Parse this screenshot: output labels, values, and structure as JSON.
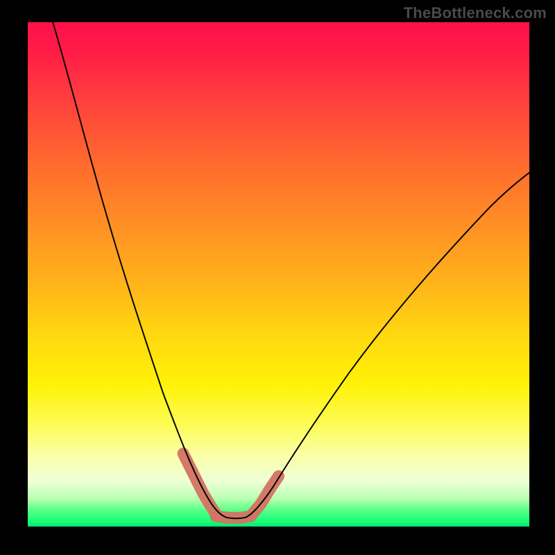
{
  "watermark": "TheBottleneck.com",
  "colors": {
    "background": "#000000",
    "watermark_text": "#4a4a4a",
    "curve": "#050505",
    "highlight": "#d47364"
  },
  "chart_data": {
    "type": "line",
    "title": "",
    "xlabel": "",
    "ylabel": "",
    "xlim": [
      0,
      100
    ],
    "ylim": [
      0,
      100
    ],
    "series": [
      {
        "name": "left-branch",
        "x": [
          5,
          8,
          12,
          16,
          20,
          24,
          28,
          31,
          33,
          35,
          36.5,
          38
        ],
        "y": [
          100,
          90,
          76,
          62,
          48,
          35,
          23,
          14,
          9,
          5,
          2.5,
          1
        ]
      },
      {
        "name": "right-branch",
        "x": [
          44,
          46,
          49,
          54,
          60,
          68,
          77,
          88,
          100
        ],
        "y": [
          1,
          3,
          7,
          14,
          22,
          32,
          43,
          56,
          70
        ]
      },
      {
        "name": "valley-floor",
        "x": [
          38,
          40,
          42,
          44
        ],
        "y": [
          1,
          0.7,
          0.7,
          1
        ]
      }
    ],
    "highlight_segments": [
      {
        "name": "left-knee",
        "x": [
          31,
          37
        ],
        "y": [
          14,
          2
        ]
      },
      {
        "name": "floor",
        "x": [
          37.5,
          44
        ],
        "y": [
          1.2,
          1.2
        ]
      },
      {
        "name": "right-knee",
        "x": [
          45,
          50
        ],
        "y": [
          2,
          9
        ]
      }
    ]
  }
}
